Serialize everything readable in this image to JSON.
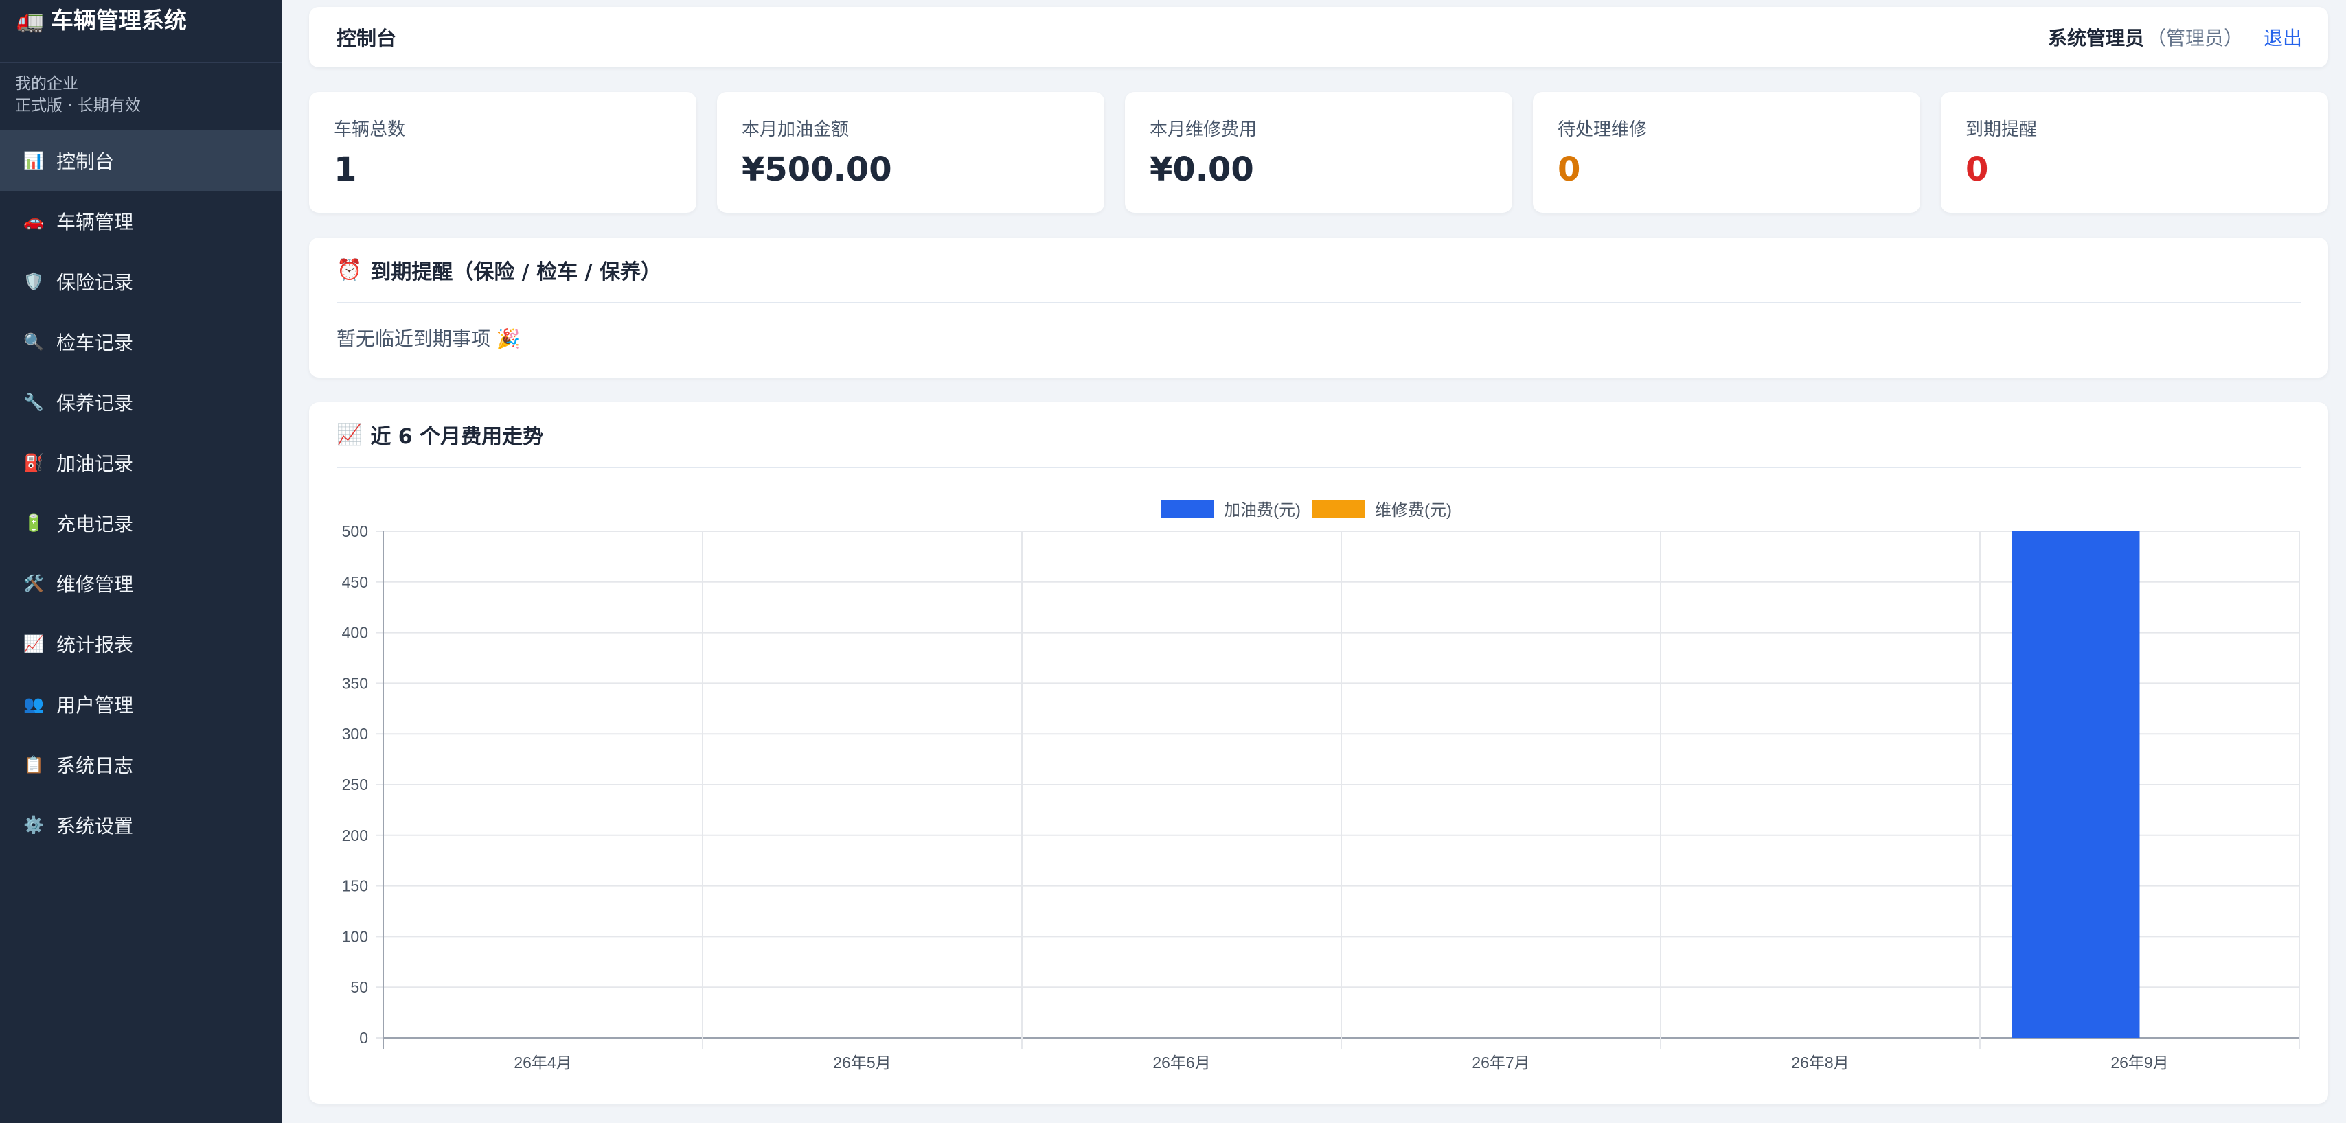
{
  "app": {
    "logo_icon": "🚛",
    "title": "车辆管理系统"
  },
  "company": {
    "name": "我的企业",
    "plan": "正式版 · 长期有效"
  },
  "sidebar": {
    "items": [
      {
        "icon": "📊",
        "icon_name": "bar-chart-icon",
        "label": "控制台",
        "active": true
      },
      {
        "icon": "🚗",
        "icon_name": "car-icon",
        "label": "车辆管理"
      },
      {
        "icon": "🛡️",
        "icon_name": "shield-icon",
        "label": "保险记录"
      },
      {
        "icon": "🔍",
        "icon_name": "magnifier-icon",
        "label": "检车记录"
      },
      {
        "icon": "🔧",
        "icon_name": "wrench-icon",
        "label": "保养记录"
      },
      {
        "icon": "⛽",
        "icon_name": "fuel-pump-icon",
        "label": "加油记录"
      },
      {
        "icon": "🔋",
        "icon_name": "battery-icon",
        "label": "充电记录"
      },
      {
        "icon": "🛠️",
        "icon_name": "tools-icon",
        "label": "维修管理"
      },
      {
        "icon": "📈",
        "icon_name": "trend-chart-icon",
        "label": "统计报表"
      },
      {
        "icon": "👥",
        "icon_name": "users-icon",
        "label": "用户管理"
      },
      {
        "icon": "📋",
        "icon_name": "clipboard-icon",
        "label": "系统日志"
      },
      {
        "icon": "⚙️",
        "icon_name": "gear-icon",
        "label": "系统设置"
      }
    ]
  },
  "header": {
    "title": "控制台",
    "user_name": "系统管理员",
    "user_role": "（管理员）",
    "logout": "退出"
  },
  "stats": [
    {
      "label": "车辆总数",
      "value": "1",
      "color": "#1e293b"
    },
    {
      "label": "本月加油金额",
      "value": "¥500.00",
      "color": "#1e293b"
    },
    {
      "label": "本月维修费用",
      "value": "¥0.00",
      "color": "#1e293b"
    },
    {
      "label": "待处理维修",
      "value": "0",
      "color": "#d97706"
    },
    {
      "label": "到期提醒",
      "value": "0",
      "color": "#dc2626"
    }
  ],
  "reminder": {
    "icon": "⏰",
    "title": "到期提醒（保险 / 检车 / 保养）",
    "empty_text": "暂无临近到期事项 🎉"
  },
  "trend": {
    "icon": "📈",
    "title": "近 6 个月费用走势"
  },
  "chart_data": {
    "type": "bar",
    "categories": [
      "26年4月",
      "26年5月",
      "26年6月",
      "26年7月",
      "26年8月",
      "26年9月"
    ],
    "series": [
      {
        "name": "加油费(元)",
        "color": "#2563eb",
        "values": [
          0,
          0,
          0,
          0,
          0,
          500
        ]
      },
      {
        "name": "维修费(元)",
        "color": "#f59e0b",
        "values": [
          0,
          0,
          0,
          0,
          0,
          0
        ]
      }
    ],
    "ylim": [
      0,
      500
    ],
    "yticks": [
      0,
      50,
      100,
      150,
      200,
      250,
      300,
      350,
      400,
      450,
      500
    ],
    "legend": "top-center",
    "grid": true
  }
}
